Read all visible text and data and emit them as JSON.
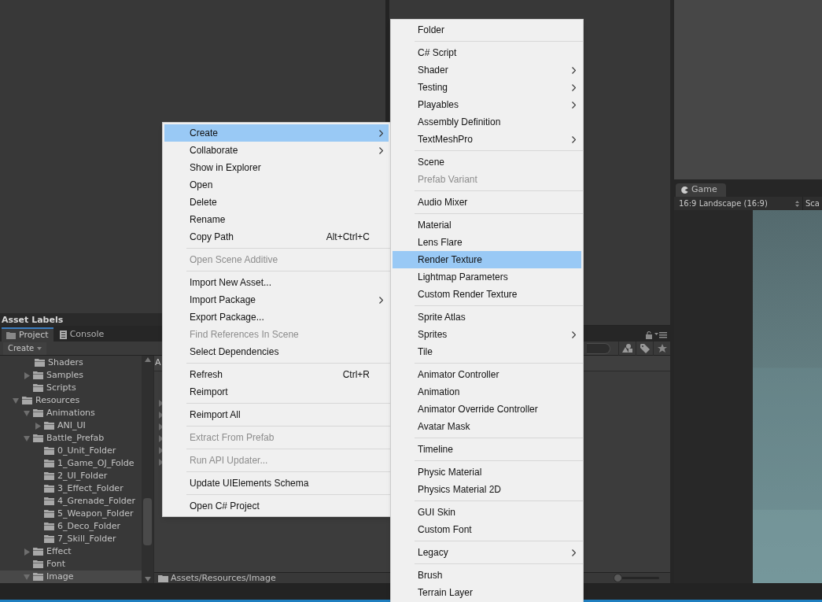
{
  "panels": {
    "asset_labels_title": "Asset Labels"
  },
  "project": {
    "tabs": [
      {
        "label": "Project",
        "selected": true
      },
      {
        "label": "Console",
        "selected": false
      }
    ],
    "create_button": "Create",
    "tree": [
      {
        "children": [
          {
            "children": [
              {
                "label": "Shaders",
                "selected": false
              }
            ]
          },
          {
            "label": "Samples",
            "expanded": false,
            "selected": false
          },
          {
            "label": "Scripts",
            "selected": false
          }
        ]
      },
      {
        "label": "Resources",
        "expanded": true,
        "selected": false,
        "children": [
          {
            "label": "Animations",
            "expanded": true,
            "selected": false,
            "children": [
              {
                "label": "ANI_UI",
                "expanded": false,
                "selected": false
              }
            ]
          },
          {
            "label": "Battle_Prefab",
            "expanded": true,
            "selected": false,
            "children": [
              {
                "label": "0_Unit_Folder",
                "selected": false
              },
              {
                "label": "1_Game_OJ_Folde",
                "selected": false
              },
              {
                "label": "2_UI_Folder",
                "selected": false
              },
              {
                "label": "3_Effect_Folder",
                "selected": false
              },
              {
                "label": "4_Grenade_Folder",
                "selected": false
              },
              {
                "label": "5_Weapon_Folder",
                "selected": false
              },
              {
                "label": "6_Deco_Folder",
                "selected": false
              },
              {
                "label": "7_Skill_Folder",
                "selected": false
              }
            ]
          },
          {
            "label": "Effect",
            "expanded": false,
            "selected": false
          },
          {
            "label": "Font",
            "selected": false
          },
          {
            "label": "Image",
            "expanded": true,
            "selected": true
          }
        ]
      }
    ],
    "content_header": "A",
    "path": "Assets/Resources/Image",
    "zoom_slider": {
      "level": 0.0
    }
  },
  "game": {
    "tab": "Game",
    "aspect": "16:9 Landscape (16:9)",
    "scale_label": "Sca"
  },
  "context_menu": [
    [
      {
        "label": "Create",
        "submenu": true,
        "selected": true,
        "disabled": false
      },
      {
        "label": "Collaborate",
        "submenu": true,
        "selected": false,
        "disabled": false
      },
      {
        "label": "Show in Explorer",
        "submenu": false,
        "selected": false,
        "disabled": false
      },
      {
        "label": "Open",
        "submenu": false,
        "selected": false,
        "disabled": false
      },
      {
        "label": "Delete",
        "submenu": false,
        "selected": false,
        "disabled": false
      },
      {
        "label": "Rename",
        "submenu": false,
        "selected": false,
        "disabled": false
      },
      {
        "label": "Copy Path",
        "shortcut": "Alt+Ctrl+C",
        "submenu": false,
        "selected": false,
        "disabled": false
      }
    ],
    [
      {
        "label": "Open Scene Additive",
        "submenu": false,
        "selected": false,
        "disabled": true
      }
    ],
    [
      {
        "label": "Import New Asset...",
        "submenu": false,
        "selected": false,
        "disabled": false
      },
      {
        "label": "Import Package",
        "submenu": true,
        "selected": false,
        "disabled": false
      },
      {
        "label": "Export Package...",
        "submenu": false,
        "selected": false,
        "disabled": false
      },
      {
        "label": "Find References In Scene",
        "submenu": false,
        "selected": false,
        "disabled": true
      },
      {
        "label": "Select Dependencies",
        "submenu": false,
        "selected": false,
        "disabled": false
      }
    ],
    [
      {
        "label": "Refresh",
        "shortcut": "Ctrl+R",
        "submenu": false,
        "selected": false,
        "disabled": false
      },
      {
        "label": "Reimport",
        "submenu": false,
        "selected": false,
        "disabled": false
      }
    ],
    [
      {
        "label": "Reimport All",
        "submenu": false,
        "selected": false,
        "disabled": false
      }
    ],
    [
      {
        "label": "Extract From Prefab",
        "submenu": false,
        "selected": false,
        "disabled": true
      }
    ],
    [
      {
        "label": "Run API Updater...",
        "submenu": false,
        "selected": false,
        "disabled": true
      }
    ],
    [
      {
        "label": "Update UIElements Schema",
        "submenu": false,
        "selected": false,
        "disabled": false
      }
    ],
    [
      {
        "label": "Open C# Project",
        "submenu": false,
        "selected": false,
        "disabled": false
      }
    ]
  ],
  "create_submenu": [
    [
      {
        "label": "Folder",
        "submenu": false,
        "selected": false,
        "disabled": false
      }
    ],
    [
      {
        "label": "C# Script",
        "submenu": false,
        "selected": false,
        "disabled": false
      },
      {
        "label": "Shader",
        "submenu": true,
        "selected": false,
        "disabled": false
      },
      {
        "label": "Testing",
        "submenu": true,
        "selected": false,
        "disabled": false
      },
      {
        "label": "Playables",
        "submenu": true,
        "selected": false,
        "disabled": false
      },
      {
        "label": "Assembly Definition",
        "submenu": false,
        "selected": false,
        "disabled": false
      },
      {
        "label": "TextMeshPro",
        "submenu": true,
        "selected": false,
        "disabled": false
      }
    ],
    [
      {
        "label": "Scene",
        "submenu": false,
        "selected": false,
        "disabled": false
      },
      {
        "label": "Prefab Variant",
        "submenu": false,
        "selected": false,
        "disabled": true
      }
    ],
    [
      {
        "label": "Audio Mixer",
        "submenu": false,
        "selected": false,
        "disabled": false
      }
    ],
    [
      {
        "label": "Material",
        "submenu": false,
        "selected": false,
        "disabled": false
      },
      {
        "label": "Lens Flare",
        "submenu": false,
        "selected": false,
        "disabled": false
      },
      {
        "label": "Render Texture",
        "submenu": false,
        "selected": true,
        "disabled": false
      },
      {
        "label": "Lightmap Parameters",
        "submenu": false,
        "selected": false,
        "disabled": false
      },
      {
        "label": "Custom Render Texture",
        "submenu": false,
        "selected": false,
        "disabled": false
      }
    ],
    [
      {
        "label": "Sprite Atlas",
        "submenu": false,
        "selected": false,
        "disabled": false
      },
      {
        "label": "Sprites",
        "submenu": true,
        "selected": false,
        "disabled": false
      },
      {
        "label": "Tile",
        "submenu": false,
        "selected": false,
        "disabled": false
      }
    ],
    [
      {
        "label": "Animator Controller",
        "submenu": false,
        "selected": false,
        "disabled": false
      },
      {
        "label": "Animation",
        "submenu": false,
        "selected": false,
        "disabled": false
      },
      {
        "label": "Animator Override Controller",
        "submenu": false,
        "selected": false,
        "disabled": false
      },
      {
        "label": "Avatar Mask",
        "submenu": false,
        "selected": false,
        "disabled": false
      }
    ],
    [
      {
        "label": "Timeline",
        "submenu": false,
        "selected": false,
        "disabled": false
      }
    ],
    [
      {
        "label": "Physic Material",
        "submenu": false,
        "selected": false,
        "disabled": false
      },
      {
        "label": "Physics Material 2D",
        "submenu": false,
        "selected": false,
        "disabled": false
      }
    ],
    [
      {
        "label": "GUI Skin",
        "submenu": false,
        "selected": false,
        "disabled": false
      },
      {
        "label": "Custom Font",
        "submenu": false,
        "selected": false,
        "disabled": false
      }
    ],
    [
      {
        "label": "Legacy",
        "submenu": true,
        "selected": false,
        "disabled": false
      }
    ],
    [
      {
        "label": "Brush",
        "submenu": false,
        "selected": false,
        "disabled": false
      },
      {
        "label": "Terrain Layer",
        "submenu": false,
        "selected": false,
        "disabled": false
      }
    ]
  ]
}
